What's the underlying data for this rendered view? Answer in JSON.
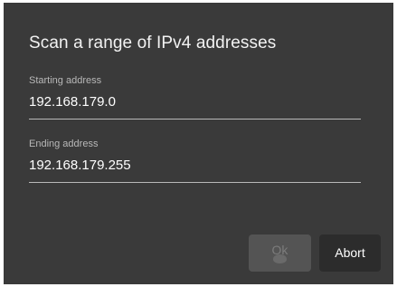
{
  "dialog": {
    "title": "Scan a range of IPv4 addresses",
    "start": {
      "label": "Starting address",
      "value": "192.168.179.0"
    },
    "end": {
      "label": "Ending address",
      "value": "192.168.179.255"
    },
    "buttons": {
      "ok_label": "Ok",
      "abort_label": "Abort"
    }
  },
  "colors": {
    "dialog_bg": "#3a3a3a",
    "ok_disabled_bg": "#545454",
    "abort_bg": "#2c2c2c",
    "underline": "#b9b9b9"
  }
}
